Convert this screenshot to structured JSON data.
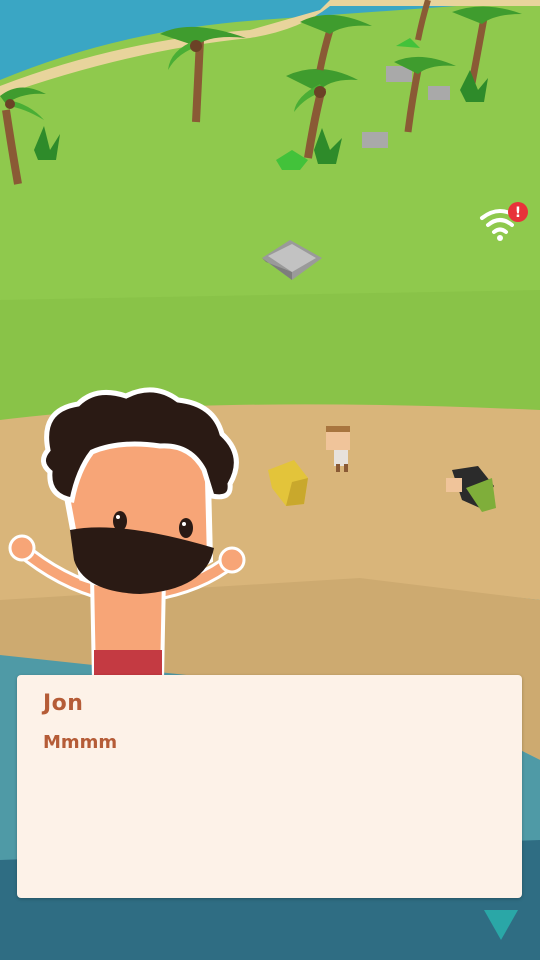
{
  "dialog": {
    "speaker": "Jon",
    "message": "Mmmm"
  },
  "indicators": {
    "connection_icon": "wifi-warning-icon",
    "alert_glyph": "!",
    "continue_icon": "triangle-down-icon"
  },
  "colors": {
    "grass": "#8fc94d",
    "sand": "#d9b57a",
    "sea": "#3aa6c4",
    "dialog_bg": "#fdf2e8",
    "dialog_text": "#b55c37",
    "continue_arrow": "#2aa7a7",
    "alert": "#e8323a"
  }
}
